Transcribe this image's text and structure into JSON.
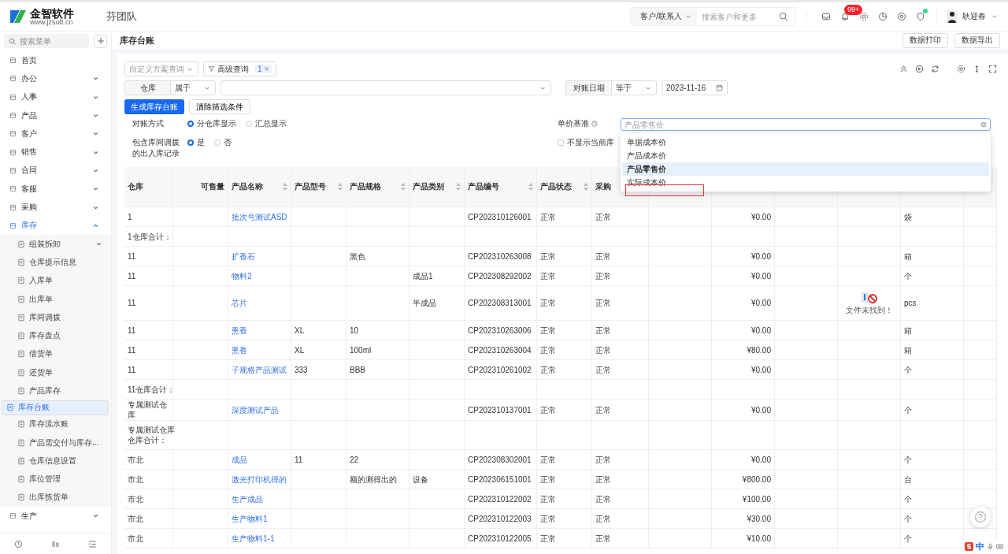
{
  "header": {
    "logo_name": "金智软件",
    "logo_url": "www.jzsoft.cn",
    "team": "芬团队",
    "search_scope": "客户/联系人",
    "search_placeholder": "搜索客户和更多",
    "badge": "99+",
    "user": "耿迎春"
  },
  "sidebar": {
    "search_placeholder": "搜索菜单",
    "items": [
      {
        "label": "首页",
        "expandable": false,
        "expanded": false
      },
      {
        "label": "办公",
        "expandable": true,
        "expanded": false
      },
      {
        "label": "人事",
        "expandable": true,
        "expanded": false
      },
      {
        "label": "产品",
        "expandable": true,
        "expanded": false
      },
      {
        "label": "客户",
        "expandable": true,
        "expanded": false
      },
      {
        "label": "销售",
        "expandable": true,
        "expanded": false
      },
      {
        "label": "合同",
        "expandable": true,
        "expanded": false
      },
      {
        "label": "客服",
        "expandable": true,
        "expanded": false
      },
      {
        "label": "采购",
        "expandable": true,
        "expanded": false
      },
      {
        "label": "库存",
        "expandable": true,
        "expanded": true,
        "children": [
          {
            "label": "组装拆卸",
            "expandable": true,
            "selected": false
          },
          {
            "label": "仓库提示信息",
            "expandable": false,
            "selected": false
          },
          {
            "label": "入库单",
            "expandable": false,
            "selected": false
          },
          {
            "label": "出库单",
            "expandable": false,
            "selected": false
          },
          {
            "label": "库间调拨",
            "expandable": false,
            "selected": false
          },
          {
            "label": "库存盘点",
            "expandable": false,
            "selected": false
          },
          {
            "label": "借货单",
            "expandable": false,
            "selected": false
          },
          {
            "label": "还货单",
            "expandable": false,
            "selected": false
          },
          {
            "label": "产品库存",
            "expandable": false,
            "selected": false
          },
          {
            "label": "库存台账",
            "expandable": false,
            "selected": true
          },
          {
            "label": "库存流水账",
            "expandable": false,
            "selected": false
          },
          {
            "label": "产品需交付与库存...",
            "expandable": false,
            "selected": false
          },
          {
            "label": "仓库信息设置",
            "expandable": false,
            "selected": false
          },
          {
            "label": "库位管理",
            "expandable": false,
            "selected": false
          },
          {
            "label": "出库拣货单",
            "expandable": false,
            "selected": false
          }
        ]
      },
      {
        "label": "生产",
        "expandable": true,
        "expanded": false
      }
    ]
  },
  "page": {
    "title": "库存台账",
    "buttons": [
      "数据打印",
      "数据导出"
    ]
  },
  "filters": {
    "scheme_placeholder": "自定义方案查询",
    "advanced_query": "高级查询",
    "advanced_count": "1",
    "advanced_clear": "×",
    "conditions": [
      {
        "field": "仓库",
        "operator": "属于"
      },
      {
        "field": "对账日期",
        "operator": "等于",
        "value": "2023-11-16"
      }
    ],
    "primary_button": "生成库存台账",
    "clear_button": "清除筛选条件"
  },
  "options": {
    "mode_label": "对账方式",
    "modes": [
      {
        "label": "分仓库显示",
        "selected": true
      },
      {
        "label": "汇总显示",
        "selected": false
      }
    ],
    "transfer_label": "包含库间调拨的出入库记录",
    "transfer": [
      {
        "label": "是",
        "selected": true
      },
      {
        "label": "否",
        "selected": false
      }
    ],
    "price_label": "单价基准",
    "price_placeholder": "产品零售价",
    "hide_label": "不显示当前库",
    "hide_checked": false,
    "price_options": [
      {
        "label": "单据成本价",
        "selected": false
      },
      {
        "label": "产品成本价",
        "selected": false
      },
      {
        "label": "产品零售价",
        "selected": true
      },
      {
        "label": "实际成本价",
        "selected": false
      }
    ]
  },
  "table": {
    "columns": [
      "仓库",
      "可售量",
      "产品名称",
      "产品型号",
      "产品规格",
      "产品类别",
      "产品编号",
      "产品状态",
      "采购"
    ],
    "rows": [
      {
        "kind": "item",
        "warehouse": "1",
        "name": "批次号测试ASD",
        "model": "",
        "spec": "",
        "category": "",
        "code": "CP202310126001",
        "status": "正常",
        "purchase": "正常",
        "price": "¥0.00",
        "unit": "袋"
      },
      {
        "kind": "subtotal",
        "warehouse": "1仓库合计："
      },
      {
        "kind": "item",
        "warehouse": "11",
        "name": "扩香石",
        "model": "",
        "spec": "黑色",
        "category": "",
        "code": "CP202310263008",
        "status": "正常",
        "purchase": "正常",
        "price": "¥0.00",
        "unit": "箱"
      },
      {
        "kind": "item",
        "warehouse": "11",
        "name": "物料2",
        "model": "",
        "spec": "",
        "category": "成品1",
        "code": "CP202308292002",
        "status": "正常",
        "purchase": "正常",
        "price": "¥0.00",
        "unit": "个"
      },
      {
        "kind": "item",
        "warehouse": "11",
        "name": "芯片",
        "model": "",
        "spec": "",
        "category": "半成品",
        "code": "CP202308313001",
        "status": "正常",
        "purchase": "正常",
        "price": "¥0.00",
        "image_caption": "文件未找到！",
        "unit": "pcs"
      },
      {
        "kind": "item",
        "warehouse": "11",
        "name": "熏香",
        "model": "XL",
        "spec": "10",
        "category": "",
        "code": "CP202310263006",
        "status": "正常",
        "purchase": "正常",
        "price": "¥0.00",
        "unit": "箱"
      },
      {
        "kind": "item",
        "warehouse": "11",
        "name": "熏香",
        "model": "XL",
        "spec": "100ml",
        "category": "",
        "code": "CP202310263004",
        "status": "正常",
        "purchase": "正常",
        "price": "¥80.00",
        "unit": "箱"
      },
      {
        "kind": "item",
        "warehouse": "11",
        "name": "子规格产品测试",
        "model": "333",
        "spec": "BBB",
        "category": "",
        "code": "CP202310261002",
        "status": "正常",
        "purchase": "正常",
        "price": "¥0.00",
        "unit": "个"
      },
      {
        "kind": "subtotal",
        "warehouse": "11仓库合计："
      },
      {
        "kind": "item",
        "warehouse": "专属测试仓库",
        "name": "深度测试产品",
        "model": "",
        "spec": "",
        "category": "",
        "code": "CP202310137001",
        "status": "正常",
        "purchase": "正常",
        "price": "¥0.00",
        "unit": "个"
      },
      {
        "kind": "subtotal",
        "warehouse": "专属测试仓库仓库合计："
      },
      {
        "kind": "item",
        "warehouse": "市北",
        "name": "成品",
        "model": "11",
        "spec": "22",
        "category": "",
        "code": "CP202308302001",
        "status": "正常",
        "purchase": "正常",
        "price": "¥0.00",
        "unit": "个"
      },
      {
        "kind": "item",
        "warehouse": "市北",
        "name": "激光打印机得的",
        "model": "",
        "spec": "额的测得出的",
        "category": "设备",
        "code": "CP202306151001",
        "status": "正常",
        "purchase": "正常",
        "price": "¥800.00",
        "unit": "台"
      },
      {
        "kind": "item",
        "warehouse": "市北",
        "name": "生产成品",
        "model": "",
        "spec": "",
        "category": "",
        "code": "CP202310122002",
        "status": "正常",
        "purchase": "正常",
        "price": "¥100.00",
        "unit": "个"
      },
      {
        "kind": "item",
        "warehouse": "市北",
        "name": "生产物料1",
        "model": "",
        "spec": "",
        "category": "",
        "code": "CP202310122003",
        "status": "正常",
        "purchase": "正常",
        "price": "¥30.00",
        "unit": "个"
      },
      {
        "kind": "item",
        "warehouse": "市北",
        "name": "生产物料1-1",
        "model": "",
        "spec": "",
        "category": "",
        "code": "CP202310122005",
        "status": "正常",
        "purchase": "正常",
        "price": "¥10.00",
        "unit": "个"
      }
    ]
  },
  "ime": {
    "label": "中"
  }
}
